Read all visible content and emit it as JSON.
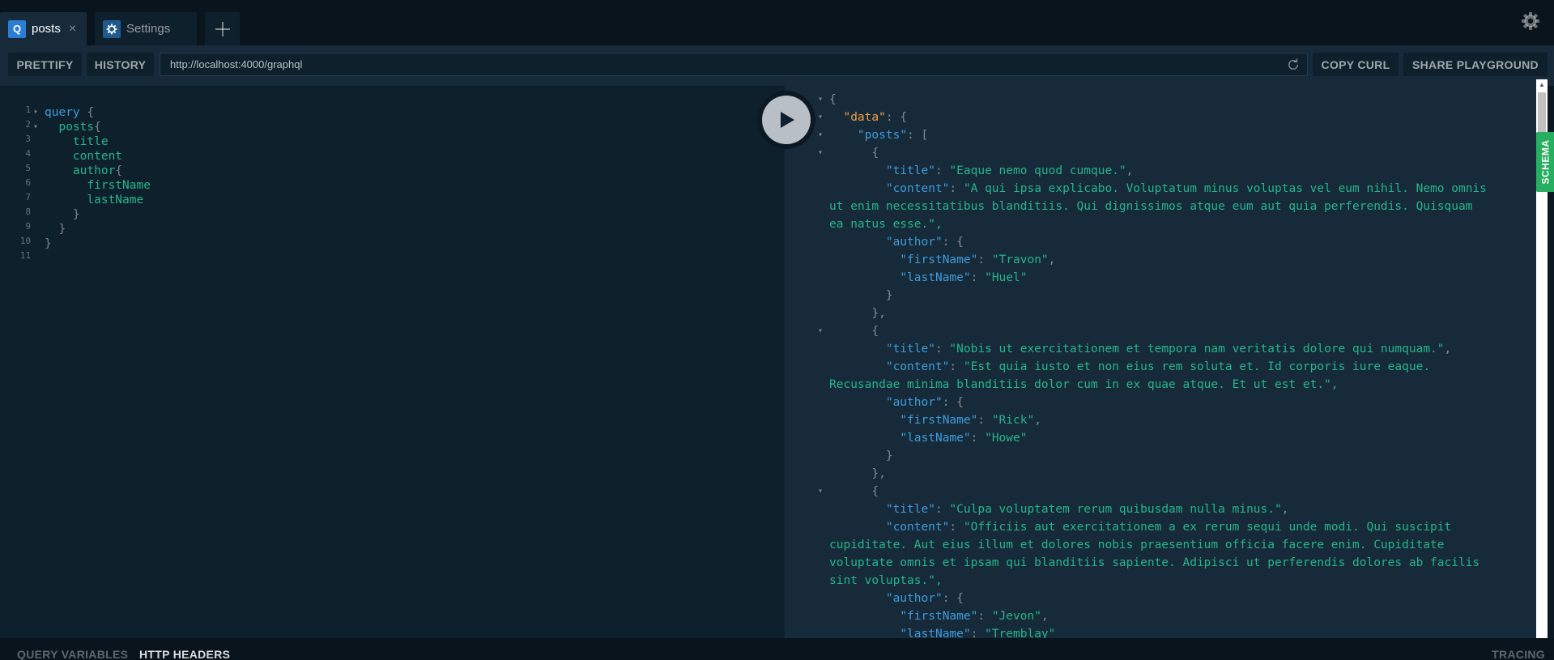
{
  "tabs": [
    {
      "badge": "Q",
      "label": "posts",
      "close": "×"
    },
    {
      "label": "Settings"
    }
  ],
  "toolbar": {
    "prettify_label": "PRETTIFY",
    "history_label": "HISTORY",
    "url": "http://localhost:4000/graphql",
    "copy_curl_label": "COPY CURL",
    "share_label": "SHARE PLAYGROUND"
  },
  "editor": {
    "lines": [
      {
        "num": "1",
        "fold": "▾",
        "text": "query {"
      },
      {
        "num": "2",
        "fold": "▾",
        "text": "  posts{"
      },
      {
        "num": "3",
        "fold": "",
        "text": "    title"
      },
      {
        "num": "4",
        "fold": "",
        "text": "    content"
      },
      {
        "num": "5",
        "fold": "",
        "text": "    author{"
      },
      {
        "num": "6",
        "fold": "",
        "text": "      firstName"
      },
      {
        "num": "7",
        "fold": "",
        "text": "      lastName"
      },
      {
        "num": "8",
        "fold": "",
        "text": "    }"
      },
      {
        "num": "9",
        "fold": "",
        "text": "  }"
      },
      {
        "num": "10",
        "fold": "",
        "text": "}"
      },
      {
        "num": "11",
        "fold": "",
        "text": ""
      }
    ]
  },
  "result": {
    "lines": [
      {
        "fold": "▾",
        "text": "{"
      },
      {
        "fold": "▾",
        "text": "  \"data\": {"
      },
      {
        "fold": "▾",
        "text": "    \"posts\": ["
      },
      {
        "fold": "▾",
        "text": "      {"
      },
      {
        "fold": "",
        "text": "        \"title\": \"Eaque nemo quod cumque.\","
      },
      {
        "fold": "",
        "text": "        \"content\": \"A qui ipsa explicabo. Voluptatum minus voluptas vel eum nihil. Nemo omnis"
      },
      {
        "fold": "",
        "text": "ut enim necessitatibus blanditiis. Qui dignissimos atque eum aut quia perferendis. Quisquam"
      },
      {
        "fold": "",
        "text": "ea natus esse.\","
      },
      {
        "fold": "",
        "text": "        \"author\": {"
      },
      {
        "fold": "",
        "text": "          \"firstName\": \"Travon\","
      },
      {
        "fold": "",
        "text": "          \"lastName\": \"Huel\""
      },
      {
        "fold": "",
        "text": "        }"
      },
      {
        "fold": "",
        "text": "      },"
      },
      {
        "fold": "▾",
        "text": "      {"
      },
      {
        "fold": "",
        "text": "        \"title\": \"Nobis ut exercitationem et tempora nam veritatis dolore qui numquam.\","
      },
      {
        "fold": "",
        "text": "        \"content\": \"Est quia iusto et non eius rem soluta et. Id corporis iure eaque."
      },
      {
        "fold": "",
        "text": "Recusandae minima blanditiis dolor cum in ex quae atque. Et ut est et.\","
      },
      {
        "fold": "",
        "text": "        \"author\": {"
      },
      {
        "fold": "",
        "text": "          \"firstName\": \"Rick\","
      },
      {
        "fold": "",
        "text": "          \"lastName\": \"Howe\""
      },
      {
        "fold": "",
        "text": "        }"
      },
      {
        "fold": "",
        "text": "      },"
      },
      {
        "fold": "▾",
        "text": "      {"
      },
      {
        "fold": "",
        "text": "        \"title\": \"Culpa voluptatem rerum quibusdam nulla minus.\","
      },
      {
        "fold": "",
        "text": "        \"content\": \"Officiis aut exercitationem a ex rerum sequi unde modi. Qui suscipit"
      },
      {
        "fold": "",
        "text": "cupiditate. Aut eius illum et dolores nobis praesentium officia facere enim. Cupiditate"
      },
      {
        "fold": "",
        "text": "voluptate omnis et ipsam qui blanditiis sapiente. Adipisci ut perferendis dolores ab facilis"
      },
      {
        "fold": "",
        "text": "sint voluptas.\","
      },
      {
        "fold": "",
        "text": "        \"author\": {"
      },
      {
        "fold": "",
        "text": "          \"firstName\": \"Jevon\","
      },
      {
        "fold": "",
        "text": "          \"lastName\": \"Tremblay\""
      }
    ]
  },
  "side": {
    "schema_label": "SCHEMA"
  },
  "bottom": {
    "query_variables_label": "QUERY VARIABLES",
    "http_headers_label": "HTTP HEADERS",
    "tracing_label": "TRACING"
  },
  "colors": {
    "background": "#0f202d",
    "toolbar": "#172a3a",
    "keyword": "#3d9cdb",
    "string": "#26b58a",
    "data_key": "#f0a045",
    "schema_tab": "#27ae60",
    "tab_badge": "#2a7ed3"
  },
  "icons": [
    "close-icon",
    "gear-icon",
    "plus-icon",
    "reload-icon",
    "play-icon",
    "settings-gear-icon"
  ]
}
